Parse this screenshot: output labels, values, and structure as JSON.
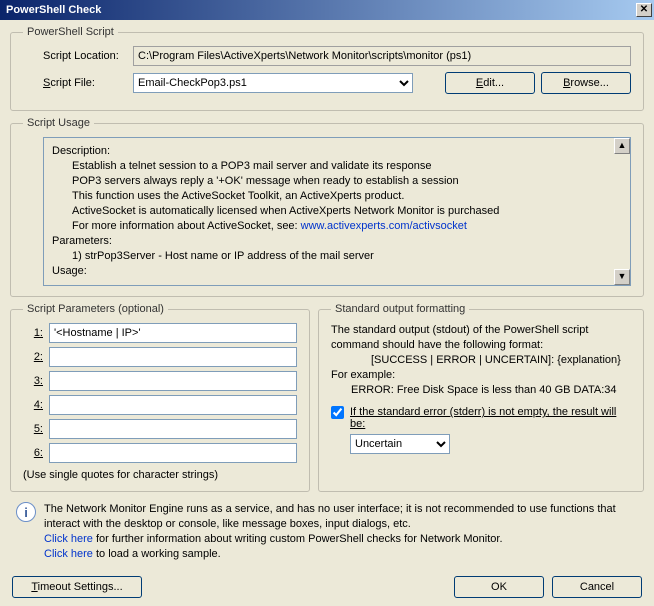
{
  "window": {
    "title": "PowerShell Check"
  },
  "script_section": {
    "legend": "PowerShell Script",
    "location_label": "Script Location:",
    "location_value": "C:\\Program Files\\ActiveXperts\\Network Monitor\\scripts\\monitor (ps1)",
    "file_label": "Script File:",
    "file_value": "Email-CheckPop3.ps1",
    "edit_btn": "Edit...",
    "browse_btn": "Browse..."
  },
  "usage_section": {
    "legend": "Script Usage",
    "desc_label": "Description:",
    "desc_line1": "Establish a telnet session to a POP3 mail server and validate its response",
    "desc_line2": "POP3 servers always reply a '+OK' message when ready to establish a session",
    "desc_line3": "This function uses the ActiveSocket Toolkit, an ActiveXperts product.",
    "desc_line4": "ActiveSocket is automatically licensed when ActiveXperts Network Monitor is purchased",
    "desc_line5_prefix": "For more information about ActiveSocket, see: ",
    "desc_line5_link": "www.activexperts.com/activsocket",
    "params_label": "Parameters:",
    "params_line1": "1) strPop3Server - Host name or IP address of the mail server",
    "usage_label": "Usage:"
  },
  "params_section": {
    "legend": "Script Parameters (optional)",
    "labels": [
      "1:",
      "2:",
      "3:",
      "4:",
      "5:",
      "6:"
    ],
    "values": [
      "'<Hostname | IP>'",
      "",
      "",
      "",
      "",
      ""
    ],
    "hint": "(Use single quotes for character strings)"
  },
  "stdout_section": {
    "legend": "Standard output formatting",
    "line1": "The standard output (stdout) of the PowerShell script command should have the following format:",
    "line2": "[SUCCESS | ERROR | UNCERTAIN]: {explanation}",
    "line3": "For example:",
    "line4": "ERROR: Free Disk Space is less than 40 GB DATA:34",
    "check_label": "If the standard error (stderr) is not empty, the result will be:",
    "select_value": "Uncertain"
  },
  "info": {
    "line1": "The Network Monitor Engine runs as a service, and has no user interface; it is not recommended to use functions that interact with the desktop or console, like message boxes, input dialogs, etc.",
    "link1_text": "Click here",
    "link1_rest": " for further information about writing custom PowerShell checks for Network Monitor.",
    "link2_text": "Click here",
    "link2_rest": " to load a working sample."
  },
  "footer": {
    "timeout_btn": "Timeout Settings...",
    "ok_btn": "OK",
    "cancel_btn": "Cancel"
  }
}
